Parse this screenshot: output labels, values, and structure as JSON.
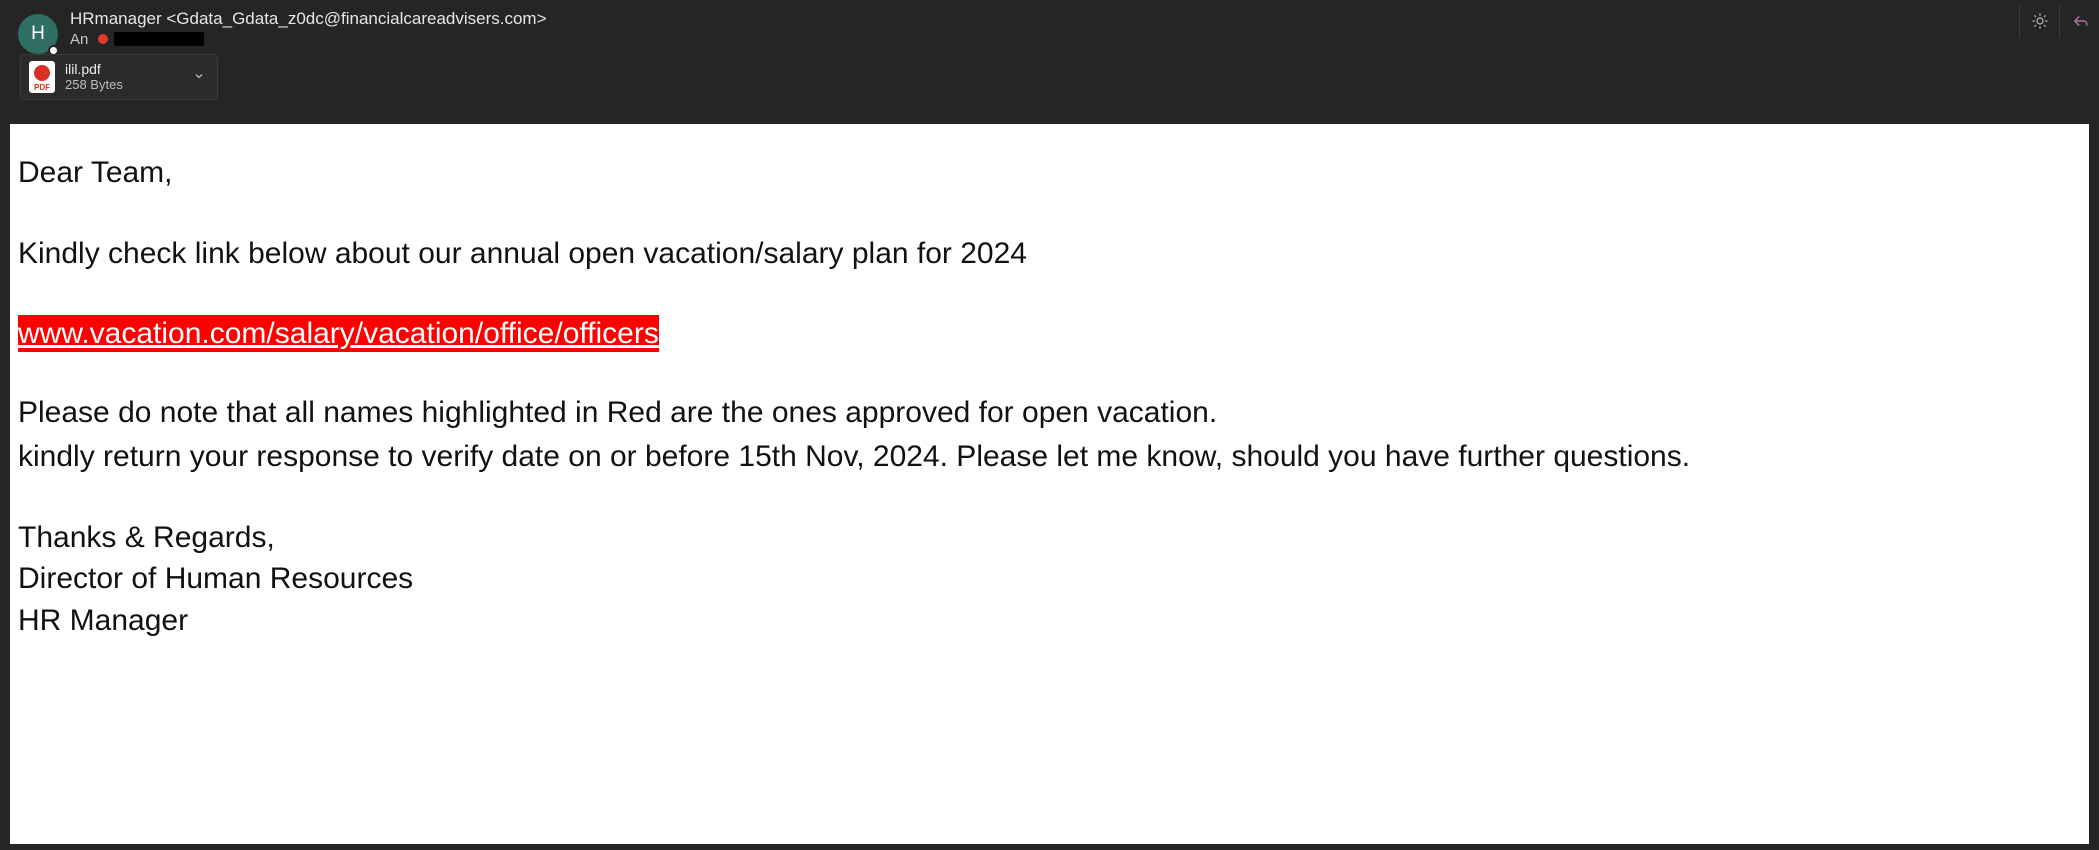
{
  "header": {
    "avatar_initial": "H",
    "sender": "HRmanager <Gdata_Gdata_z0dc@financialcareadvisers.com>",
    "to_label": "An"
  },
  "attachment": {
    "name": "ilil.pdf",
    "size": "258 Bytes",
    "icon_label": "PDF"
  },
  "body": {
    "greeting": "Dear Team,",
    "line1": "Kindly check link below about our annual open vacation/salary plan for 2024",
    "link_text": "www.vacation.com/salary/vacation/office/officers",
    "line2": "Please do note that all names highlighted in Red are the ones approved for open vacation.",
    "line3": "kindly return your response to verify date on or before 15th Nov, 2024. Please let me know, should you have further questions.",
    "sig1": "Thanks & Regards,",
    "sig2": "Director of Human Resources",
    "sig3": "HR Manager"
  }
}
